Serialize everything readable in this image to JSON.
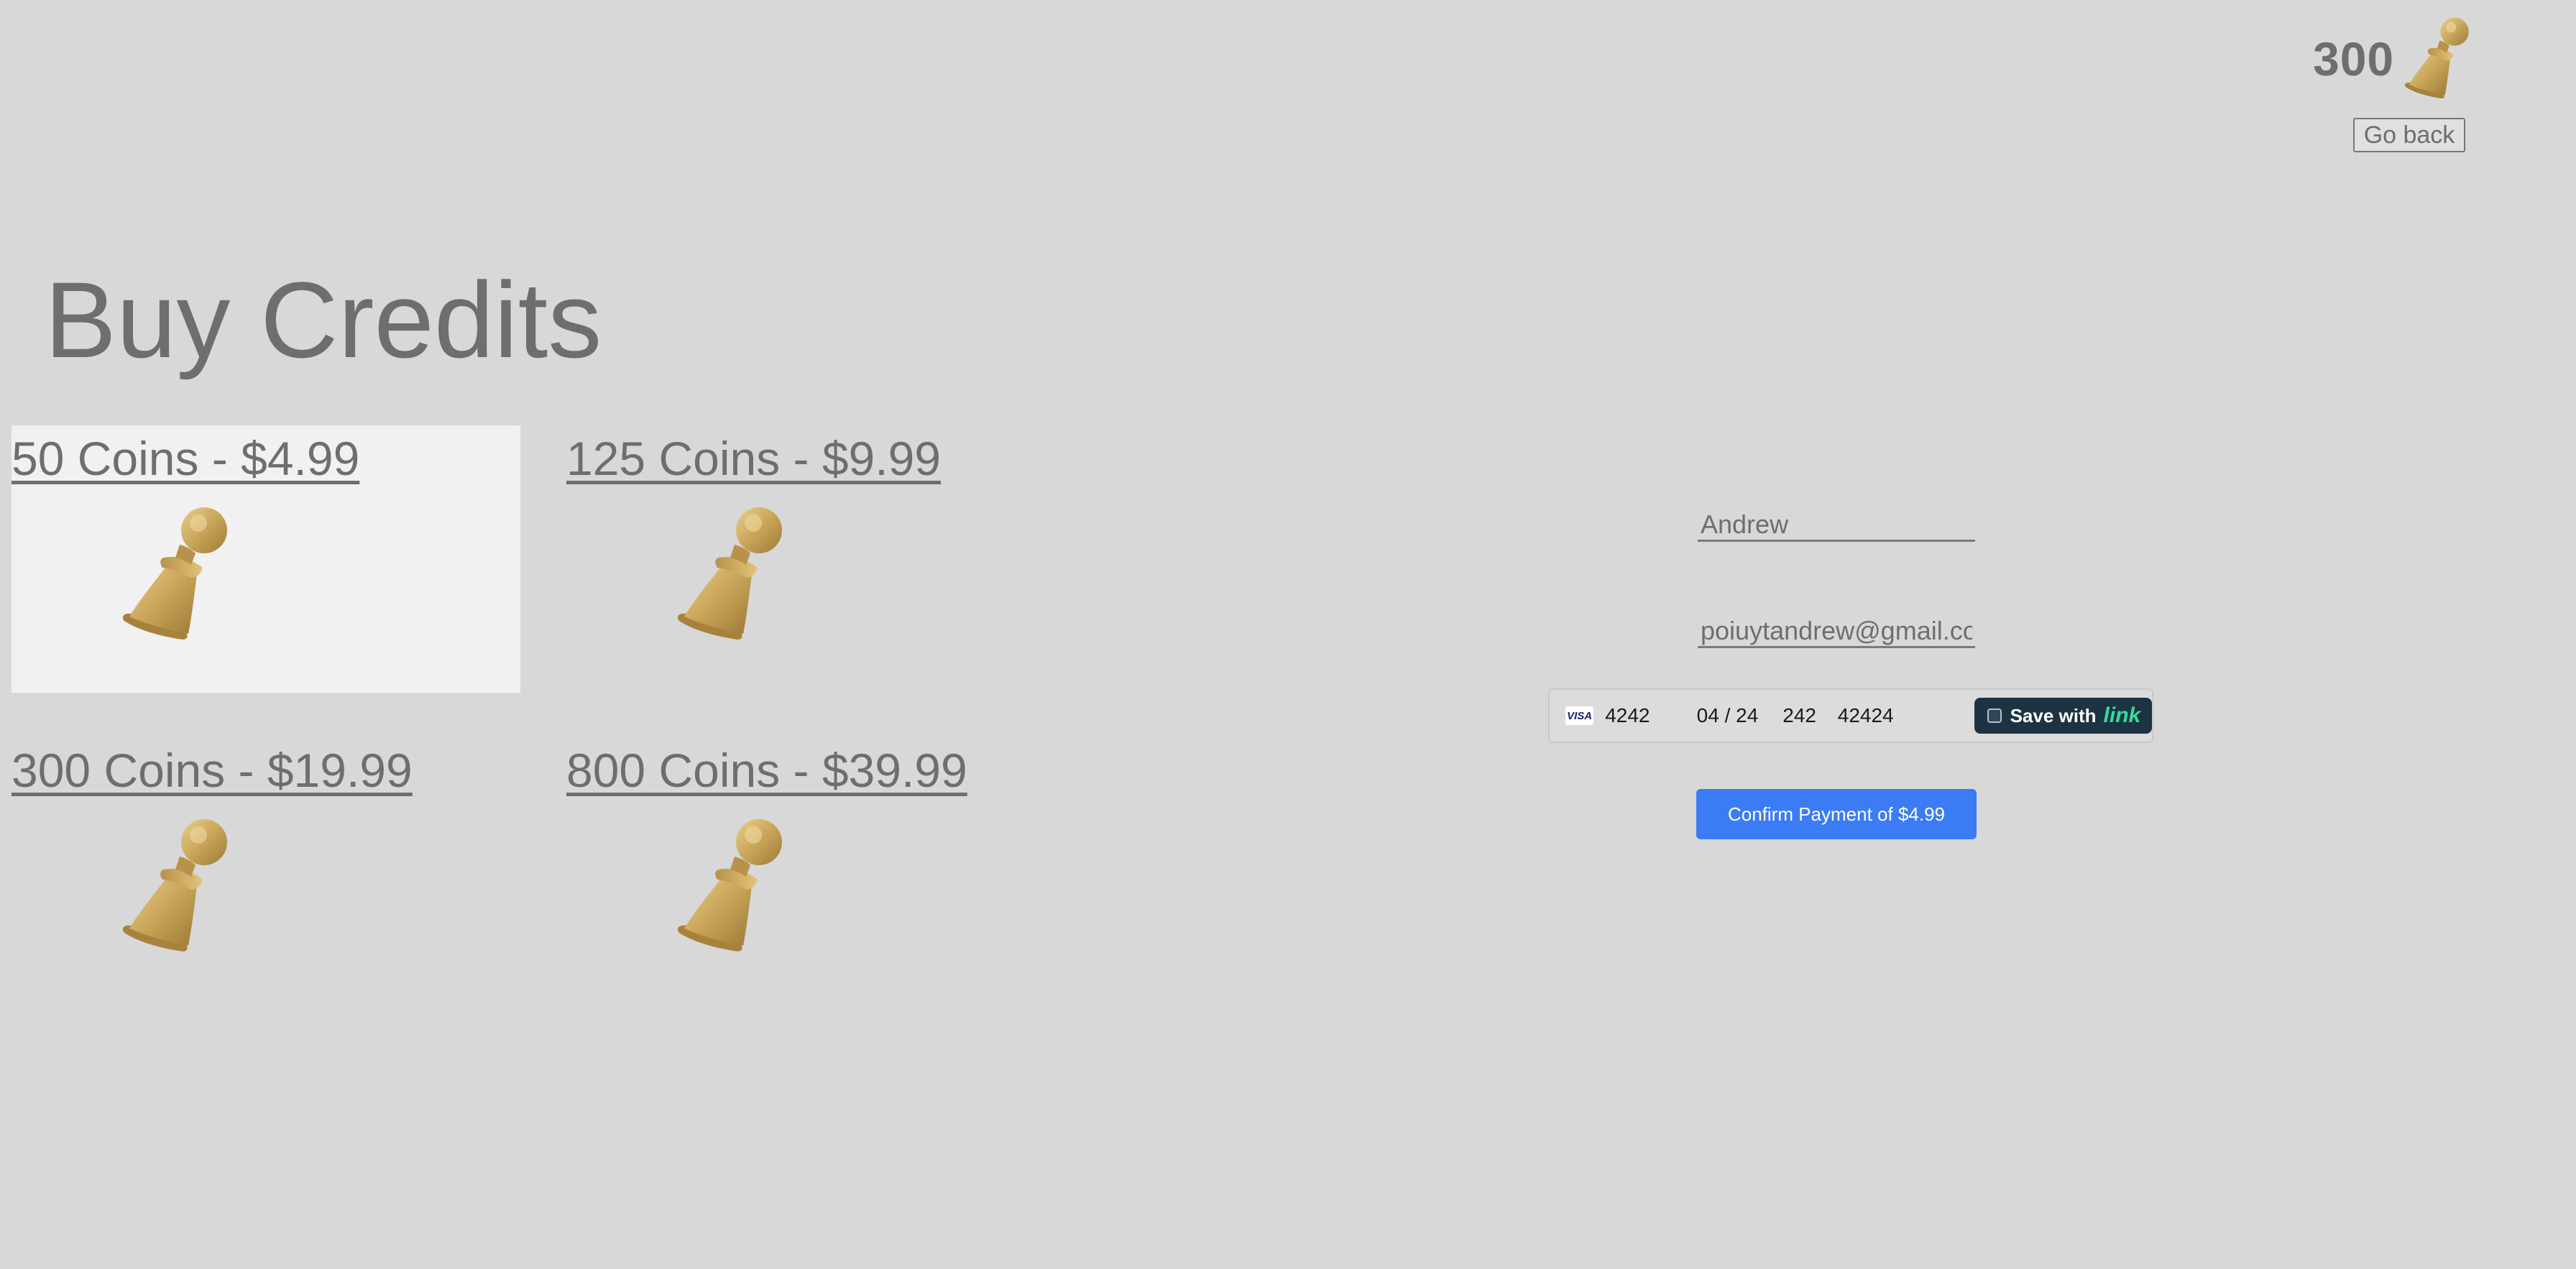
{
  "header": {
    "balance": "300",
    "balance_icon": "pawn-coin-icon",
    "go_back_label": "Go back"
  },
  "page_title": "Buy Credits",
  "packages": [
    {
      "label": "50 Coins - $4.99",
      "icon": "pawn-coin-icon",
      "selected": true
    },
    {
      "label": "125 Coins - $9.99",
      "icon": "pawn-coin-icon",
      "selected": false
    },
    {
      "label": "300 Coins - $19.99",
      "icon": "pawn-coin-icon",
      "selected": false
    },
    {
      "label": "800 Coins - $39.99",
      "icon": "pawn-coin-icon",
      "selected": false
    }
  ],
  "payment": {
    "name_value": "Andrew",
    "email_value": "poiuytandrew@gmail.co",
    "card": {
      "brand": "VISA",
      "number": "4242",
      "expiry": "04 / 24",
      "cvc": "242",
      "zip": "42424"
    },
    "link_save": {
      "label": "Save with",
      "brand": "link",
      "checked": false
    },
    "confirm_label": "Confirm Payment of $4.99"
  },
  "colors": {
    "background": "#d8d8d8",
    "selected_package_bg": "#f1f1f1",
    "text": "#6e6e6e",
    "confirm_button": "#3b7cf5",
    "link_button_bg": "#1d3342",
    "link_brand": "#33dd9e",
    "pawn_gold": "#c9a55a"
  }
}
